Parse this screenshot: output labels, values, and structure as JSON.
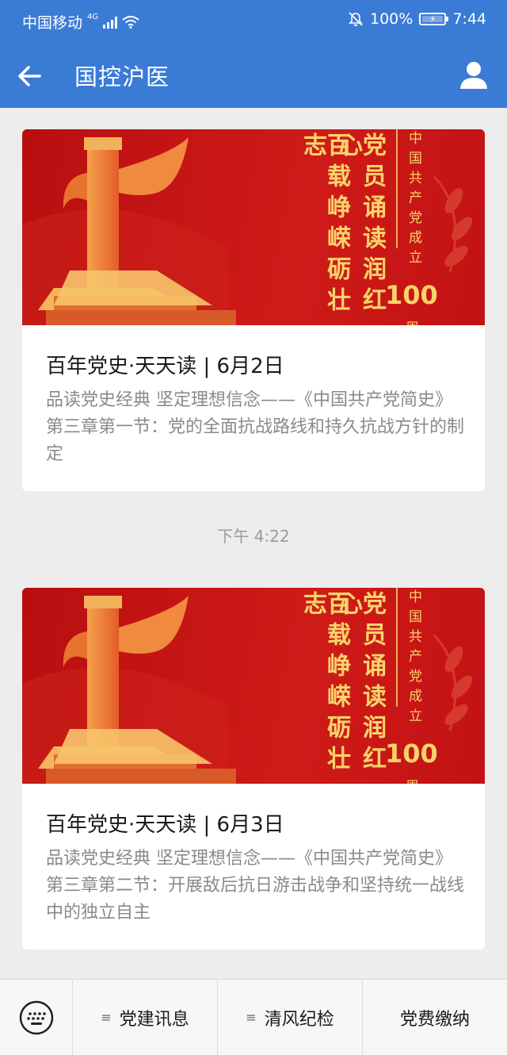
{
  "status_bar": {
    "carrier": "中国移动",
    "network": "4G",
    "battery": "100%",
    "time": "7:44"
  },
  "header": {
    "title": "国控沪医"
  },
  "cards": [
    {
      "banner": {
        "col1": "百载峥嵘砺壮志",
        "col2": "党员诵读润红心",
        "side": "中国共产党成立",
        "number": "100",
        "zhou": "周"
      },
      "title": "百年党史·天天读 | 6月2日",
      "desc": "品读党史经典 坚定理想信念——《中国共产党简史》第三章第一节：党的全面抗战路线和持久抗战方针的制定"
    },
    {
      "banner": {
        "col1": "百载峥嵘砺壮志",
        "col2": "党员诵读润红心",
        "side": "中国共产党成立",
        "number": "100",
        "zhou": "周"
      },
      "title": "百年党史·天天读 | 6月3日",
      "desc": "品读党史经典 坚定理想信念——《中国共产党简史》第三章第二节：开展敌后抗日游击战争和坚持统一战线中的独立自主"
    }
  ],
  "timestamp": "下午 4:22",
  "bottom_menu": [
    {
      "label": "党建讯息",
      "icon": "menu-icon"
    },
    {
      "label": "清风纪检",
      "icon": "menu-icon"
    },
    {
      "label": "党费缴纳",
      "icon": ""
    }
  ],
  "colors": {
    "header": "#3a7bd5",
    "banner_red": "#c8161a",
    "banner_gold": "#f8d36a"
  }
}
